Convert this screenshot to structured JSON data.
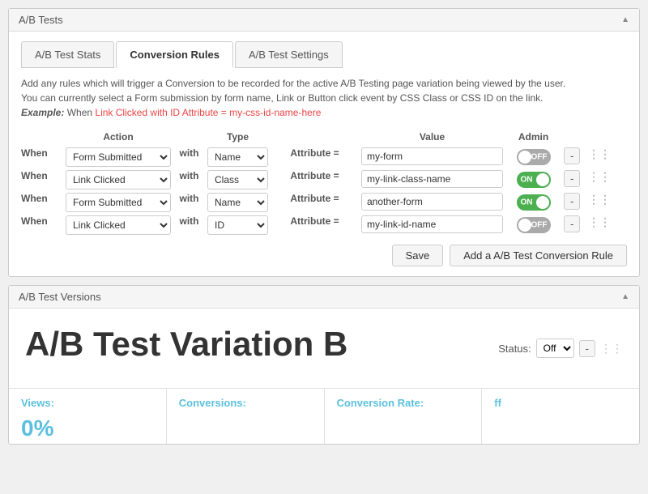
{
  "panel1": {
    "title": "A/B Tests",
    "tabs": [
      {
        "id": "stats",
        "label": "A/B Test Stats",
        "active": false
      },
      {
        "id": "conversion",
        "label": "Conversion Rules",
        "active": true
      },
      {
        "id": "settings",
        "label": "A/B Test Settings",
        "active": false
      }
    ],
    "description": {
      "line1": "Add any rules which will trigger a Conversion to be recorded for the active A/B Testing page variation being viewed by the user.",
      "line2": "You can currently select a Form submission by form name, Link or Button click event by CSS Class or CSS ID on the link.",
      "example_label": "Example:",
      "example_text": " When ",
      "example_link": "Link Clicked with ID Attribute = my-css-id-name-here"
    },
    "table": {
      "headers": {
        "action": "Action",
        "type": "Type",
        "value": "Value",
        "admin": "Admin"
      },
      "rows": [
        {
          "id": 1,
          "when": "When",
          "action": "Form Submitted",
          "with": "with",
          "type": "Name",
          "attr": "Attribute =",
          "value": "my-form",
          "toggle": "off",
          "action_options": [
            "Form Submitted",
            "Link Clicked"
          ],
          "type_options": [
            "Name",
            "Class",
            "ID"
          ]
        },
        {
          "id": 2,
          "when": "When",
          "action": "Link Clicked",
          "with": "with",
          "type": "Class",
          "attr": "Attribute =",
          "value": "my-link-class-name",
          "toggle": "on",
          "action_options": [
            "Form Submitted",
            "Link Clicked"
          ],
          "type_options": [
            "Name",
            "Class",
            "ID"
          ]
        },
        {
          "id": 3,
          "when": "When",
          "action": "Form Submitted",
          "with": "with",
          "type": "Name",
          "attr": "Attribute =",
          "value": "another-form",
          "toggle": "on",
          "action_options": [
            "Form Submitted",
            "Link Clicked"
          ],
          "type_options": [
            "Name",
            "Class",
            "ID"
          ]
        },
        {
          "id": 4,
          "when": "When",
          "action": "Link Clicked",
          "with": "with",
          "type": "ID",
          "attr": "Attribute =",
          "value": "my-link-id-name",
          "toggle": "off",
          "action_options": [
            "Form Submitted",
            "Link Clicked"
          ],
          "type_options": [
            "Name",
            "Class",
            "ID"
          ]
        }
      ]
    },
    "buttons": {
      "save": "Save",
      "add": "Add a A/B Test Conversion Rule"
    }
  },
  "panel2": {
    "title": "A/B Test Versions",
    "version_title": "A/B Test Variation B",
    "status_label": "Status:",
    "status_options": [
      "Off",
      "On"
    ],
    "status_value": "Off",
    "remove_label": "-",
    "stats": [
      {
        "label": "Views:",
        "value": "0%"
      },
      {
        "label": "Conversions:",
        "value": ""
      },
      {
        "label": "Conversion Rate:",
        "value": ""
      },
      {
        "label": "ff",
        "value": ""
      }
    ]
  }
}
